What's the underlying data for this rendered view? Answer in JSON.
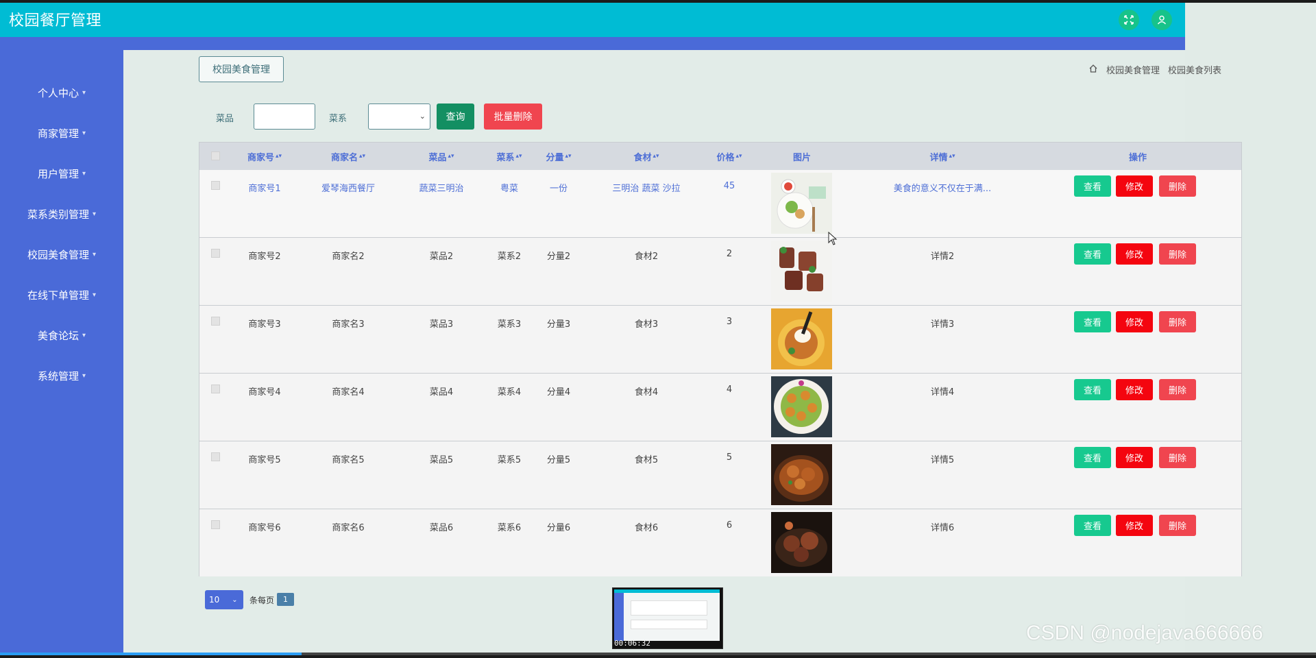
{
  "app": {
    "title": "校园餐厅管理"
  },
  "sidebar": {
    "items": [
      {
        "label": "个人中心"
      },
      {
        "label": "商家管理"
      },
      {
        "label": "用户管理"
      },
      {
        "label": "菜系类别管理"
      },
      {
        "label": "校园美食管理"
      },
      {
        "label": "在线下单管理"
      },
      {
        "label": "美食论坛"
      },
      {
        "label": "系统管理"
      }
    ]
  },
  "page": {
    "title": "校园美食管理",
    "breadcrumb": [
      "校园美食管理",
      "校园美食列表"
    ]
  },
  "search": {
    "dish_label": "菜品",
    "cuisine_label": "菜系",
    "query_button": "查询",
    "batch_delete_button": "批量删除"
  },
  "table": {
    "columns": [
      "商家号",
      "商家名",
      "菜品",
      "菜系",
      "分量",
      "食材",
      "价格",
      "图片",
      "详情",
      "操作"
    ],
    "rows": [
      {
        "merchant_no": "商家号1",
        "merchant_name": "爱琴海西餐厅",
        "dish": "蔬菜三明治",
        "cuisine": "粤菜",
        "portion": "一份",
        "ingredients": "三明治 蔬菜 沙拉",
        "price": "45",
        "detail": "美食的意义不仅在于满..."
      },
      {
        "merchant_no": "商家号2",
        "merchant_name": "商家名2",
        "dish": "菜品2",
        "cuisine": "菜系2",
        "portion": "分量2",
        "ingredients": "食材2",
        "price": "2",
        "detail": "详情2"
      },
      {
        "merchant_no": "商家号3",
        "merchant_name": "商家名3",
        "dish": "菜品3",
        "cuisine": "菜系3",
        "portion": "分量3",
        "ingredients": "食材3",
        "price": "3",
        "detail": "详情3"
      },
      {
        "merchant_no": "商家号4",
        "merchant_name": "商家名4",
        "dish": "菜品4",
        "cuisine": "菜系4",
        "portion": "分量4",
        "ingredients": "食材4",
        "price": "4",
        "detail": "详情4"
      },
      {
        "merchant_no": "商家号5",
        "merchant_name": "商家名5",
        "dish": "菜品5",
        "cuisine": "菜系5",
        "portion": "分量5",
        "ingredients": "食材5",
        "price": "5",
        "detail": "详情5"
      },
      {
        "merchant_no": "商家号6",
        "merchant_name": "商家名6",
        "dish": "菜品6",
        "cuisine": "菜系6",
        "portion": "分量6",
        "ingredients": "食材6",
        "price": "6",
        "detail": "详情6"
      }
    ],
    "actions": {
      "view": "查看",
      "edit": "修改",
      "delete": "删除"
    }
  },
  "pagination": {
    "page_size": "10",
    "per_page_label": "条每页",
    "current_page": "1"
  },
  "video": {
    "timestamp": "00:06:32",
    "watermark": "CSDN @nodejava666666"
  },
  "colors": {
    "header": "#00bcd4",
    "sidebar": "#4a6ad8",
    "view_button": "#17c98f",
    "edit_button": "#f4050f",
    "delete_button": "#f0454f",
    "query_button": "#138f62",
    "batch_delete_button": "#f0454f"
  }
}
